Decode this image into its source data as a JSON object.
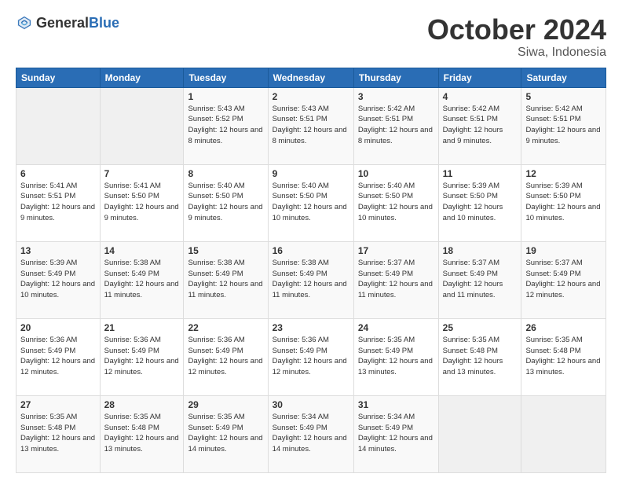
{
  "header": {
    "logo_general": "General",
    "logo_blue": "Blue",
    "month_title": "October 2024",
    "location": "Siwa, Indonesia"
  },
  "weekdays": [
    "Sunday",
    "Monday",
    "Tuesday",
    "Wednesday",
    "Thursday",
    "Friday",
    "Saturday"
  ],
  "weeks": [
    [
      {
        "day": "",
        "info": ""
      },
      {
        "day": "",
        "info": ""
      },
      {
        "day": "1",
        "info": "Sunrise: 5:43 AM\nSunset: 5:52 PM\nDaylight: 12 hours and 8 minutes."
      },
      {
        "day": "2",
        "info": "Sunrise: 5:43 AM\nSunset: 5:51 PM\nDaylight: 12 hours and 8 minutes."
      },
      {
        "day": "3",
        "info": "Sunrise: 5:42 AM\nSunset: 5:51 PM\nDaylight: 12 hours and 8 minutes."
      },
      {
        "day": "4",
        "info": "Sunrise: 5:42 AM\nSunset: 5:51 PM\nDaylight: 12 hours and 9 minutes."
      },
      {
        "day": "5",
        "info": "Sunrise: 5:42 AM\nSunset: 5:51 PM\nDaylight: 12 hours and 9 minutes."
      }
    ],
    [
      {
        "day": "6",
        "info": "Sunrise: 5:41 AM\nSunset: 5:51 PM\nDaylight: 12 hours and 9 minutes."
      },
      {
        "day": "7",
        "info": "Sunrise: 5:41 AM\nSunset: 5:50 PM\nDaylight: 12 hours and 9 minutes."
      },
      {
        "day": "8",
        "info": "Sunrise: 5:40 AM\nSunset: 5:50 PM\nDaylight: 12 hours and 9 minutes."
      },
      {
        "day": "9",
        "info": "Sunrise: 5:40 AM\nSunset: 5:50 PM\nDaylight: 12 hours and 10 minutes."
      },
      {
        "day": "10",
        "info": "Sunrise: 5:40 AM\nSunset: 5:50 PM\nDaylight: 12 hours and 10 minutes."
      },
      {
        "day": "11",
        "info": "Sunrise: 5:39 AM\nSunset: 5:50 PM\nDaylight: 12 hours and 10 minutes."
      },
      {
        "day": "12",
        "info": "Sunrise: 5:39 AM\nSunset: 5:50 PM\nDaylight: 12 hours and 10 minutes."
      }
    ],
    [
      {
        "day": "13",
        "info": "Sunrise: 5:39 AM\nSunset: 5:49 PM\nDaylight: 12 hours and 10 minutes."
      },
      {
        "day": "14",
        "info": "Sunrise: 5:38 AM\nSunset: 5:49 PM\nDaylight: 12 hours and 11 minutes."
      },
      {
        "day": "15",
        "info": "Sunrise: 5:38 AM\nSunset: 5:49 PM\nDaylight: 12 hours and 11 minutes."
      },
      {
        "day": "16",
        "info": "Sunrise: 5:38 AM\nSunset: 5:49 PM\nDaylight: 12 hours and 11 minutes."
      },
      {
        "day": "17",
        "info": "Sunrise: 5:37 AM\nSunset: 5:49 PM\nDaylight: 12 hours and 11 minutes."
      },
      {
        "day": "18",
        "info": "Sunrise: 5:37 AM\nSunset: 5:49 PM\nDaylight: 12 hours and 11 minutes."
      },
      {
        "day": "19",
        "info": "Sunrise: 5:37 AM\nSunset: 5:49 PM\nDaylight: 12 hours and 12 minutes."
      }
    ],
    [
      {
        "day": "20",
        "info": "Sunrise: 5:36 AM\nSunset: 5:49 PM\nDaylight: 12 hours and 12 minutes."
      },
      {
        "day": "21",
        "info": "Sunrise: 5:36 AM\nSunset: 5:49 PM\nDaylight: 12 hours and 12 minutes."
      },
      {
        "day": "22",
        "info": "Sunrise: 5:36 AM\nSunset: 5:49 PM\nDaylight: 12 hours and 12 minutes."
      },
      {
        "day": "23",
        "info": "Sunrise: 5:36 AM\nSunset: 5:49 PM\nDaylight: 12 hours and 12 minutes."
      },
      {
        "day": "24",
        "info": "Sunrise: 5:35 AM\nSunset: 5:49 PM\nDaylight: 12 hours and 13 minutes."
      },
      {
        "day": "25",
        "info": "Sunrise: 5:35 AM\nSunset: 5:48 PM\nDaylight: 12 hours and 13 minutes."
      },
      {
        "day": "26",
        "info": "Sunrise: 5:35 AM\nSunset: 5:48 PM\nDaylight: 12 hours and 13 minutes."
      }
    ],
    [
      {
        "day": "27",
        "info": "Sunrise: 5:35 AM\nSunset: 5:48 PM\nDaylight: 12 hours and 13 minutes."
      },
      {
        "day": "28",
        "info": "Sunrise: 5:35 AM\nSunset: 5:48 PM\nDaylight: 12 hours and 13 minutes."
      },
      {
        "day": "29",
        "info": "Sunrise: 5:35 AM\nSunset: 5:49 PM\nDaylight: 12 hours and 14 minutes."
      },
      {
        "day": "30",
        "info": "Sunrise: 5:34 AM\nSunset: 5:49 PM\nDaylight: 12 hours and 14 minutes."
      },
      {
        "day": "31",
        "info": "Sunrise: 5:34 AM\nSunset: 5:49 PM\nDaylight: 12 hours and 14 minutes."
      },
      {
        "day": "",
        "info": ""
      },
      {
        "day": "",
        "info": ""
      }
    ]
  ]
}
